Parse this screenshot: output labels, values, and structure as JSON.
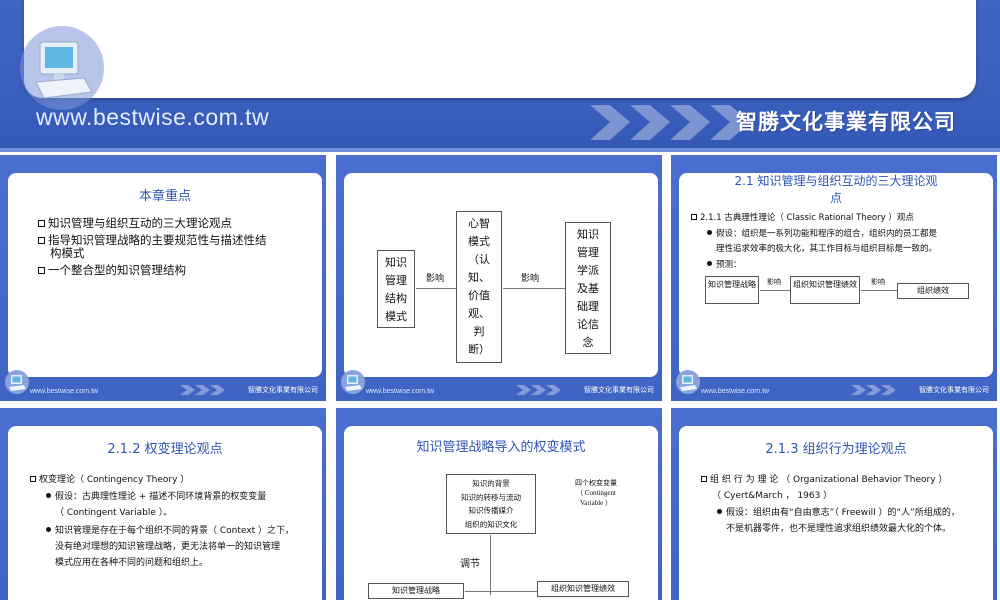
{
  "banner": {
    "url": "www.bestwise.com.tw",
    "company": "智勝文化事業有限公司"
  },
  "footer": {
    "url": "www.bestwise.com.tw",
    "company": "智勝文化事業有限公司"
  },
  "slide1": {
    "title": "本章重点",
    "items": [
      "知识管理与组织互动的三大理论观点",
      "指导知识管理战略的主要规范性与描述性结",
      "构模式",
      "一个整合型的知识管理结构"
    ]
  },
  "slide2": {
    "left_box": [
      "知识",
      "管理",
      "结构",
      "模式"
    ],
    "middle_box": [
      "心智",
      "模式",
      "（认",
      "知、",
      "价值",
      "观、",
      "判",
      "断）"
    ],
    "right_box": [
      "知识",
      "管理",
      "学派",
      "及基",
      "础理",
      "论信",
      "念"
    ],
    "arrow_label_1": "影响",
    "arrow_label_2": "影响"
  },
  "slide3": {
    "title_line1": "2.1  知识管理与组织互动的三大理论观",
    "title_line2": "点",
    "heading": "2.1.1  古典理性理论（ Classic Rational Theory ）观点",
    "assume_line1": "假设：组织是一系列功能和程序的组合，组织内的员工都是",
    "assume_line2": "理性追求效率的极大化，其工作目标与组织目标是一致的。",
    "predict": "预测：",
    "flow": [
      "知识管理战略",
      "组织知识管理绩效",
      "组织绩效"
    ],
    "flow_label": "影响"
  },
  "slide4": {
    "title": "2.1.2  权变理论观点",
    "heading": "权变理论（ Contingency Theory ）",
    "b1_line1": "假设：古典理性理论 + 描述不同环境背景的权变变量",
    "b1_line2": "（ Contingent Variable ）。",
    "b2_line1": "知识管理是存在于每个组织不同的背景（ Context ）之下，",
    "b2_line2": "没有绝对理想的知识管理战略，更无法将单一的知识管理",
    "b2_line3": "模式应用在各种不同的问题和组织上。"
  },
  "slide5": {
    "title": "知识管理战略导入的权变模式",
    "context_items": [
      "知识的背景",
      "知识的转移与流动",
      "知识传播媒介",
      "组织的知识文化"
    ],
    "side_note_1": "四个权变变量",
    "side_note_2": "（ Contingent",
    "side_note_3": "Variable ）",
    "adjust": "调节",
    "left_box": "知识管理战略",
    "right_box": "组织知识管理绩效"
  },
  "slide6": {
    "title": "2.1.3  组织行为理论观点",
    "heading_line1": "组 织 行 为 理 论 （ Organizational Behavior Theory ）",
    "heading_line2": "（ Cyert&March ， 1963 ）",
    "b1_line1": "假设：组织由有“自由意志”（ Freewill ）的“人”所组成的，",
    "b1_line2": "不是机器零件，也不是理性追求组织绩效最大化的个体。"
  }
}
